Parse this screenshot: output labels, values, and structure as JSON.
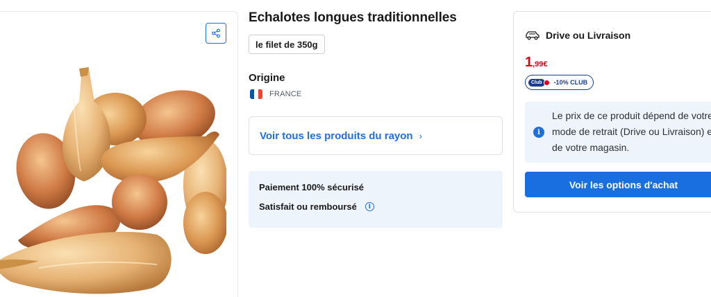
{
  "product": {
    "title": "Echalotes longues traditionnelles",
    "pack": "le filet de 350g"
  },
  "origin": {
    "label": "Origine",
    "country": "FRANCE",
    "flag_colors": [
      "#0055a4",
      "#ffffff",
      "#ef4135"
    ]
  },
  "rayon": {
    "link_label": "Voir tous les produits du rayon",
    "chevron": "›"
  },
  "assurance": {
    "line1": "Paiement 100% sécurisé",
    "line2": "Satisfait ou remboursé",
    "info_icon": "i"
  },
  "purchase": {
    "delivery_title": "Drive ou Livraison",
    "delivery_icon": "car-icon",
    "price_int": "1",
    "price_dec": ",99€",
    "club_logo": "Club",
    "club_label": "-10% CLUB",
    "info_icon": "i",
    "info_text": "Le prix de ce produit dépend de votre mode de retrait (Drive ou Livraison) et de votre magasin.",
    "cta_label": "Voir les options d'achat"
  },
  "image": {
    "share_icon": "share-icon"
  },
  "colors": {
    "accent_blue": "#1e6fd9",
    "price_red": "#e1001a",
    "club_navy": "#1a3d8f",
    "info_bg": "#eef4fb"
  }
}
